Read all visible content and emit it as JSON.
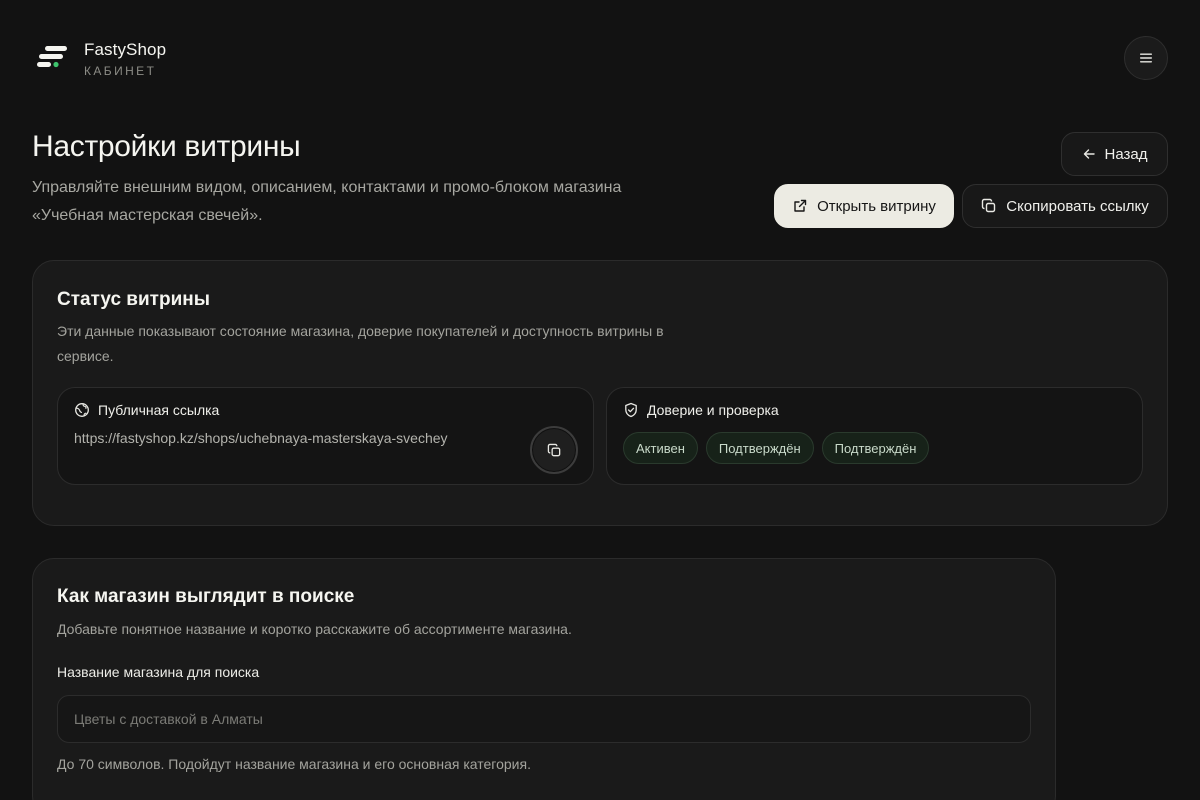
{
  "brand": {
    "name": "FastyShop",
    "subtitle": "КАБИНЕТ",
    "accent_color": "#3ec46d"
  },
  "header": {
    "menu_icon": "menu-icon"
  },
  "page": {
    "title": "Настройки витрины",
    "description": "Управляйте внешним видом, описанием, контактами и промо-блоком магазина «Учебная мастерская свечей»."
  },
  "actions": {
    "back_label": "Назад",
    "open_label": "Открыть витрину",
    "copy_link_label": "Скопировать ссылку"
  },
  "status_card": {
    "title": "Статус витрины",
    "description": "Эти данные показывают состояние магазина, доверие покупателей и доступность витрины в сервисе.",
    "public_link": {
      "title": "Публичная ссылка",
      "url": "https://fastyshop.kz/shops/uchebnaya-masterskaya-svechey"
    },
    "trust": {
      "title": "Доверие и проверка",
      "badges": [
        "Активен",
        "Подтверждён",
        "Подтверждён"
      ]
    }
  },
  "search_card": {
    "title": "Как магазин выглядит в поиске",
    "description": "Добавьте понятное название и коротко расскажите об ассортименте магазина.",
    "name_field": {
      "label": "Название магазина для поиска",
      "value": "",
      "placeholder": "Цветы с доставкой в Алматы",
      "hint": "До 70 символов. Подойдут название магазина и его основная категория."
    }
  }
}
